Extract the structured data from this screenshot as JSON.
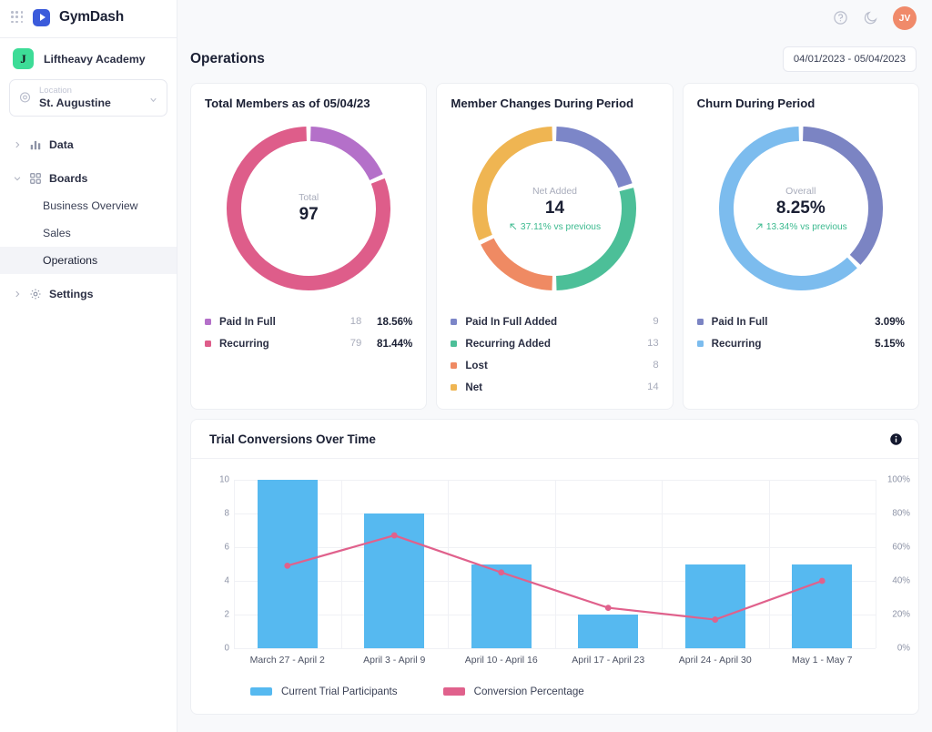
{
  "sidebar": {
    "app_grid_icon": "app-grid-icon",
    "brand": "GymDash",
    "account": {
      "initial": "J",
      "name": "Liftheavy Academy"
    },
    "location": {
      "label": "Location",
      "value": "St. Augustine"
    },
    "nav": [
      {
        "label": "Data",
        "icon": "bar-chart-icon",
        "expanded": false
      },
      {
        "label": "Boards",
        "icon": "grid-icon",
        "expanded": true
      }
    ],
    "boards_children": [
      {
        "label": "Business Overview",
        "active": false
      },
      {
        "label": "Sales",
        "active": false
      },
      {
        "label": "Operations",
        "active": true
      }
    ],
    "settings": {
      "label": "Settings",
      "icon": "gear-icon",
      "expanded": false
    }
  },
  "topbar": {
    "help_icon": "help-circle-icon",
    "theme_icon": "moon-icon",
    "avatar_initials": "JV",
    "avatar_color": "#f08a6a"
  },
  "page": {
    "title": "Operations",
    "date_range": "04/01/2023 - 05/04/2023"
  },
  "cards": [
    {
      "title": "Total Members as of 05/04/23",
      "center_label": "Total",
      "center_value": "97",
      "legend": [
        {
          "name": "Paid In Full",
          "count": "18",
          "pct": "18.56%",
          "color": "#b470c9"
        },
        {
          "name": "Recurring",
          "count": "79",
          "pct": "81.44%",
          "color": "#de5d8a"
        }
      ]
    },
    {
      "title": "Member Changes During Period",
      "center_label": "Net Added",
      "center_value": "14",
      "delta": "37.11% vs previous",
      "delta_direction": "up",
      "delta_color": "#3cba8f",
      "legend": [
        {
          "name": "Paid In Full Added",
          "count": "9",
          "color": "#7c86c8"
        },
        {
          "name": "Recurring Added",
          "count": "13",
          "color": "#4cbf98"
        },
        {
          "name": "Lost",
          "count": "8",
          "color": "#ef8a63"
        },
        {
          "name": "Net",
          "count": "14",
          "color": "#efb552"
        }
      ]
    },
    {
      "title": "Churn During Period",
      "center_label": "Overall",
      "center_value": "8.25%",
      "delta": "13.34% vs previous",
      "delta_direction": "down",
      "delta_color": "#3cba8f",
      "legend": [
        {
          "name": "Paid In Full",
          "pct": "3.09%",
          "color": "#7b84c3"
        },
        {
          "name": "Recurring",
          "pct": "5.15%",
          "color": "#7cbcee"
        }
      ]
    }
  ],
  "chart_data": {
    "type": "bar",
    "title": "Trial Conversions Over Time",
    "info_icon": "info-icon",
    "categories": [
      "March 27 - April 2",
      "April 3 - April 9",
      "April 10 - April 16",
      "April 17 - April 23",
      "April 24 - April 30",
      "May 1 - May 7"
    ],
    "series": [
      {
        "name": "Current Trial Participants",
        "type": "bar",
        "axis": "left",
        "color": "#56b9f0",
        "values": [
          10,
          8,
          5,
          2,
          5,
          5
        ]
      },
      {
        "name": "Conversion Percentage",
        "type": "line",
        "axis": "right",
        "color": "#e0618c",
        "values": [
          49,
          67,
          45,
          24,
          17,
          40
        ]
      }
    ],
    "ylabel": "",
    "ylim": [
      0,
      10
    ],
    "y_ticks": [
      "0",
      "2",
      "4",
      "6",
      "8",
      "10"
    ],
    "y2lim": [
      0,
      100
    ],
    "y2_ticks": [
      "0%",
      "20%",
      "40%",
      "60%",
      "80%",
      "100%"
    ],
    "grid": true,
    "legend_position": "bottom"
  }
}
